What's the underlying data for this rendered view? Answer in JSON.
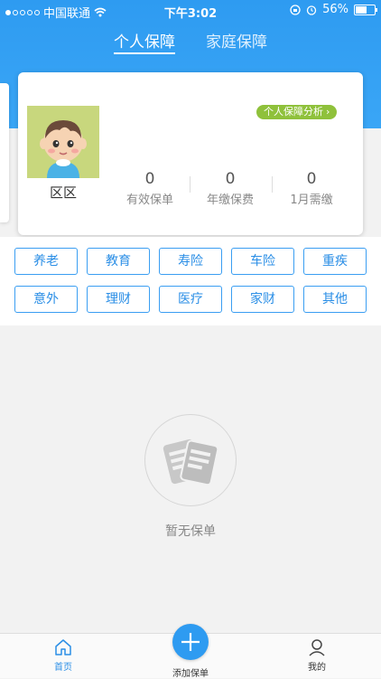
{
  "status_bar": {
    "carrier": "中国联通",
    "time": "下午3:02",
    "battery": "56%",
    "battery_level": 0.56,
    "signal_bars_filled": 1
  },
  "tabs": [
    {
      "label": "个人保障",
      "active": true
    },
    {
      "label": "家庭保障",
      "active": false
    }
  ],
  "profile": {
    "name": "区区",
    "analysis_label": "个人保障分析",
    "stats": [
      {
        "value": "0",
        "label": "有效保单"
      },
      {
        "value": "0",
        "label": "年缴保费"
      },
      {
        "value": "0",
        "label": "1月需缴"
      }
    ]
  },
  "categories": [
    "养老",
    "教育",
    "寿险",
    "车险",
    "重疾",
    "意外",
    "理财",
    "医疗",
    "家财",
    "其他"
  ],
  "empty_state": {
    "text": "暂无保单",
    "icon": "policy-document-icon"
  },
  "tab_bar": {
    "home": "首页",
    "add": "添加保单",
    "me": "我的"
  },
  "colors": {
    "primary": "#2e9bf1",
    "analysis_badge": "#8fc13b"
  }
}
